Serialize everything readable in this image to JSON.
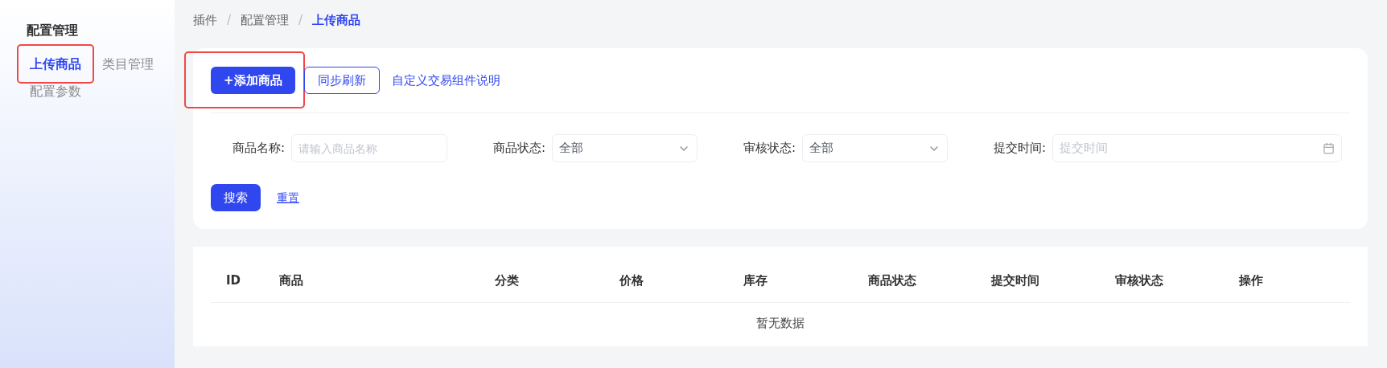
{
  "sidebar": {
    "title": "配置管理",
    "items": [
      {
        "label": "上传商品",
        "selected": true,
        "highlighted": true
      },
      {
        "label": "类目管理",
        "selected": false,
        "highlighted": false
      },
      {
        "label": "配置参数",
        "selected": false,
        "highlighted": false
      }
    ]
  },
  "breadcrumb": [
    {
      "label": "插件",
      "current": false
    },
    {
      "label": "配置管理",
      "current": false
    },
    {
      "label": "上传商品",
      "current": true
    }
  ],
  "breadcrumb_separator": "/",
  "toolbar": [
    {
      "kind": "primary",
      "label": "+添加商品",
      "highlighted": true
    },
    {
      "kind": "outline",
      "label": "同步刷新",
      "highlighted": false
    },
    {
      "kind": "link",
      "label": "自定义交易组件说明",
      "highlighted": false
    }
  ],
  "filters": [
    {
      "kind": "input",
      "label": "商品名称:",
      "placeholder": "请输入商品名称"
    },
    {
      "kind": "select",
      "label": "商品状态:",
      "value": "全部"
    },
    {
      "kind": "select",
      "label": "审核状态:",
      "value": "全部"
    },
    {
      "kind": "date",
      "label": "提交时间:",
      "placeholder": "提交时间"
    }
  ],
  "actions": [
    {
      "kind": "primary",
      "label": "搜索"
    },
    {
      "kind": "link",
      "label": "重置"
    }
  ],
  "table": {
    "columns": [
      "ID",
      "商品",
      "分类",
      "价格",
      "库存",
      "商品状态",
      "提交时间",
      "审核状态",
      "操作"
    ],
    "empty_text": "暂无数据"
  }
}
